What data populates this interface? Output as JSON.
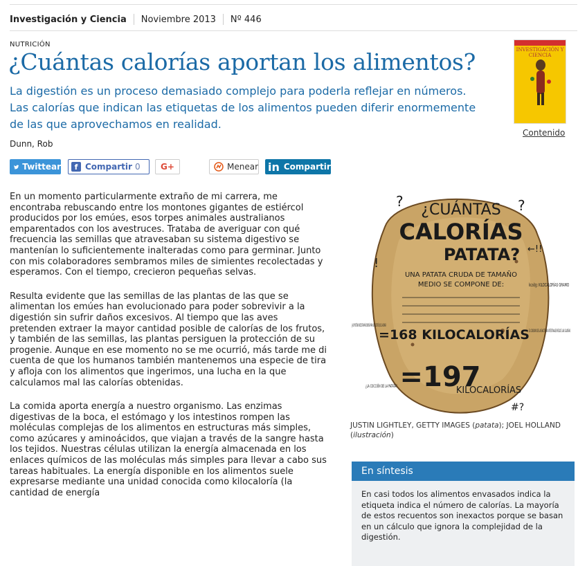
{
  "breadcrumb": {
    "publication": "Investigación y Ciencia",
    "date": "Noviembre 2013",
    "issue": "Nº 446"
  },
  "article": {
    "section": "NUTRICIÓN",
    "title": "¿Cuántas calorías aportan los alimentos?",
    "subtitle": "La digestión es un proceso demasiado complejo para poderla reflejar en números. Las calorías que indican las etiquetas de los alimentos pueden diferir enormemente de las que aprovechamos en realidad.",
    "author": "Dunn, Rob",
    "paragraphs": [
      "En un momento particularmente extraño de mi carrera, me encontraba rebuscando entre los montones gigantes de estiércol producidos por los emúes, esos torpes animales australianos emparentados con los avestruces. Trataba de averiguar con qué frecuencia las semillas que atravesaban su sistema digestivo se mantenían lo suficientemente inalteradas como para germinar. Junto con mis colaboradores sembramos miles de simientes recolectadas y esperamos. Con el tiempo, crecieron pequeñas selvas.",
      "Resulta evidente que las semillas de las plantas de las que se alimentan los emúes han evolucionado para poder sobrevivir a la digestión sin sufrir daños excesivos. Al tiempo que las aves pretenden extraer la mayor cantidad posible de calorías de los frutos, y también de las semillas, las plantas persiguen la protección de su progenie. Aunque en ese momento no se me ocurrió, más tarde me di cuenta de que los humanos también mantenemos una especie de tira y afloja con los alimentos que ingerimos, una lucha en la que calculamos mal las calorías obtenidas.",
      "La comida aporta energía a nuestro organismo. Las enzimas digestivas de la boca, el estómago y los intestinos rompen las moléculas complejas de los alimentos en estructuras más simples, como azúcares y aminoácidos, que viajan a través de la sangre hasta los tejidos. Nuestras células utilizan la energía almacenada en los enlaces químicos de las moléculas más simples para llevar a cabo sus tareas habituales. La energía disponible en los alimentos suele expresarse mediante una unidad conocida como kilocaloría (la cantidad de energía"
    ]
  },
  "social": {
    "twitter": "Twittear",
    "facebook": "Compartir",
    "facebook_count": "0",
    "googleplus": "G+",
    "meneame": "Menear",
    "linkedin": "Compartir"
  },
  "cover": {
    "name": "INVESTIGACIÓN Y CIENCIA",
    "link": "Contenido"
  },
  "illustration": {
    "lines": [
      "¿CUÁNTAS",
      "CALORÍAS",
      "PATATA?",
      "UNA PATATA CRUDA DE TAMAÑO",
      "MEDIO SE COMPONE DE:",
      "=168 KILOCALORÍAS",
      "=197",
      "KILOCALORÍAS"
    ],
    "note_left": "¿LAS PROTEÍNAS NECESITAN MÁS ENERGÍA PARA SU DIGESTIÓN QUE LA GRASA?",
    "note_right": "EL CONSUMO DE LAS BACTERIAS INTESTINALES REDUCE LAS CALORÍAS",
    "note_kcal": "kcal/g: KILOCALORÍAS GRAMO",
    "note_bottom": "¿LA COCCIÓN DE LA PATATA?"
  },
  "caption": {
    "credit1": "JUSTIN LIGHTLEY, GETTY IMAGES",
    "credit1_note": "patata",
    "credit2": "JOEL HOLLAND",
    "credit2_note": "ilustración"
  },
  "synthesis": {
    "heading": "En síntesis",
    "text": "En casi todos los alimentos envasados indica la etiqueta indica el número de calorías. La mayoría de estos recuentos son inexactos porque se basan en un cálculo que ignora la complejidad de la digestión."
  }
}
